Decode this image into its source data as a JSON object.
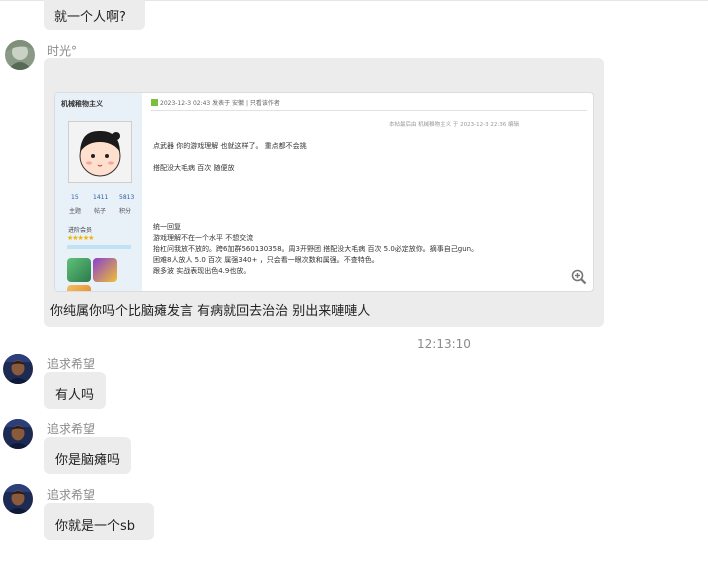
{
  "messages": {
    "m0": {
      "text": "就一个人啊?"
    },
    "m1": {
      "sender": "时光°",
      "caption": "你纯属你吗个比脑瘫发言  有病就回去治治  别出来嗹嗹人",
      "image": {
        "forum_user": "机械稚物主义",
        "header_text": "2023-12-3 02:43 发表于 安徽  |  只看该作者",
        "edit_note": "本帖最后由 机械稚物主义 于 2023-12-3 22:36 编辑",
        "stats": [
          {
            "num": "15",
            "label": "主题"
          },
          {
            "num": "1411",
            "label": "帖子"
          },
          {
            "num": "5813",
            "label": "积分"
          }
        ],
        "rank": "进阶会员",
        "stars": "★★★★★",
        "lines": [
          "点武器      你的游戏理解 也就这样了。 重点都不会挑",
          "搭配没大毛病  百次  随便放",
          "统一回复",
          "游戏理解不在一个水平   不想交流",
          "抬杠问我放不放的。跨6加群560130358。周3开野团 搭配没大毛病 百次 5.0必定放你。摘事自己gun。",
          "困难8人放人 5.0 百次 属强340+ ，只会看一眼次数和属强。不查特色。",
          "跟多波 实战表现出色4.9也放。"
        ]
      }
    },
    "timestamp": "12:13:10",
    "m2": {
      "sender": "追求希望",
      "text": "有人吗"
    },
    "m3": {
      "sender": "追求希望",
      "text": "你是脑瘫吗"
    },
    "m4": {
      "sender": "追求希望",
      "text": "你就是一个sb"
    }
  }
}
